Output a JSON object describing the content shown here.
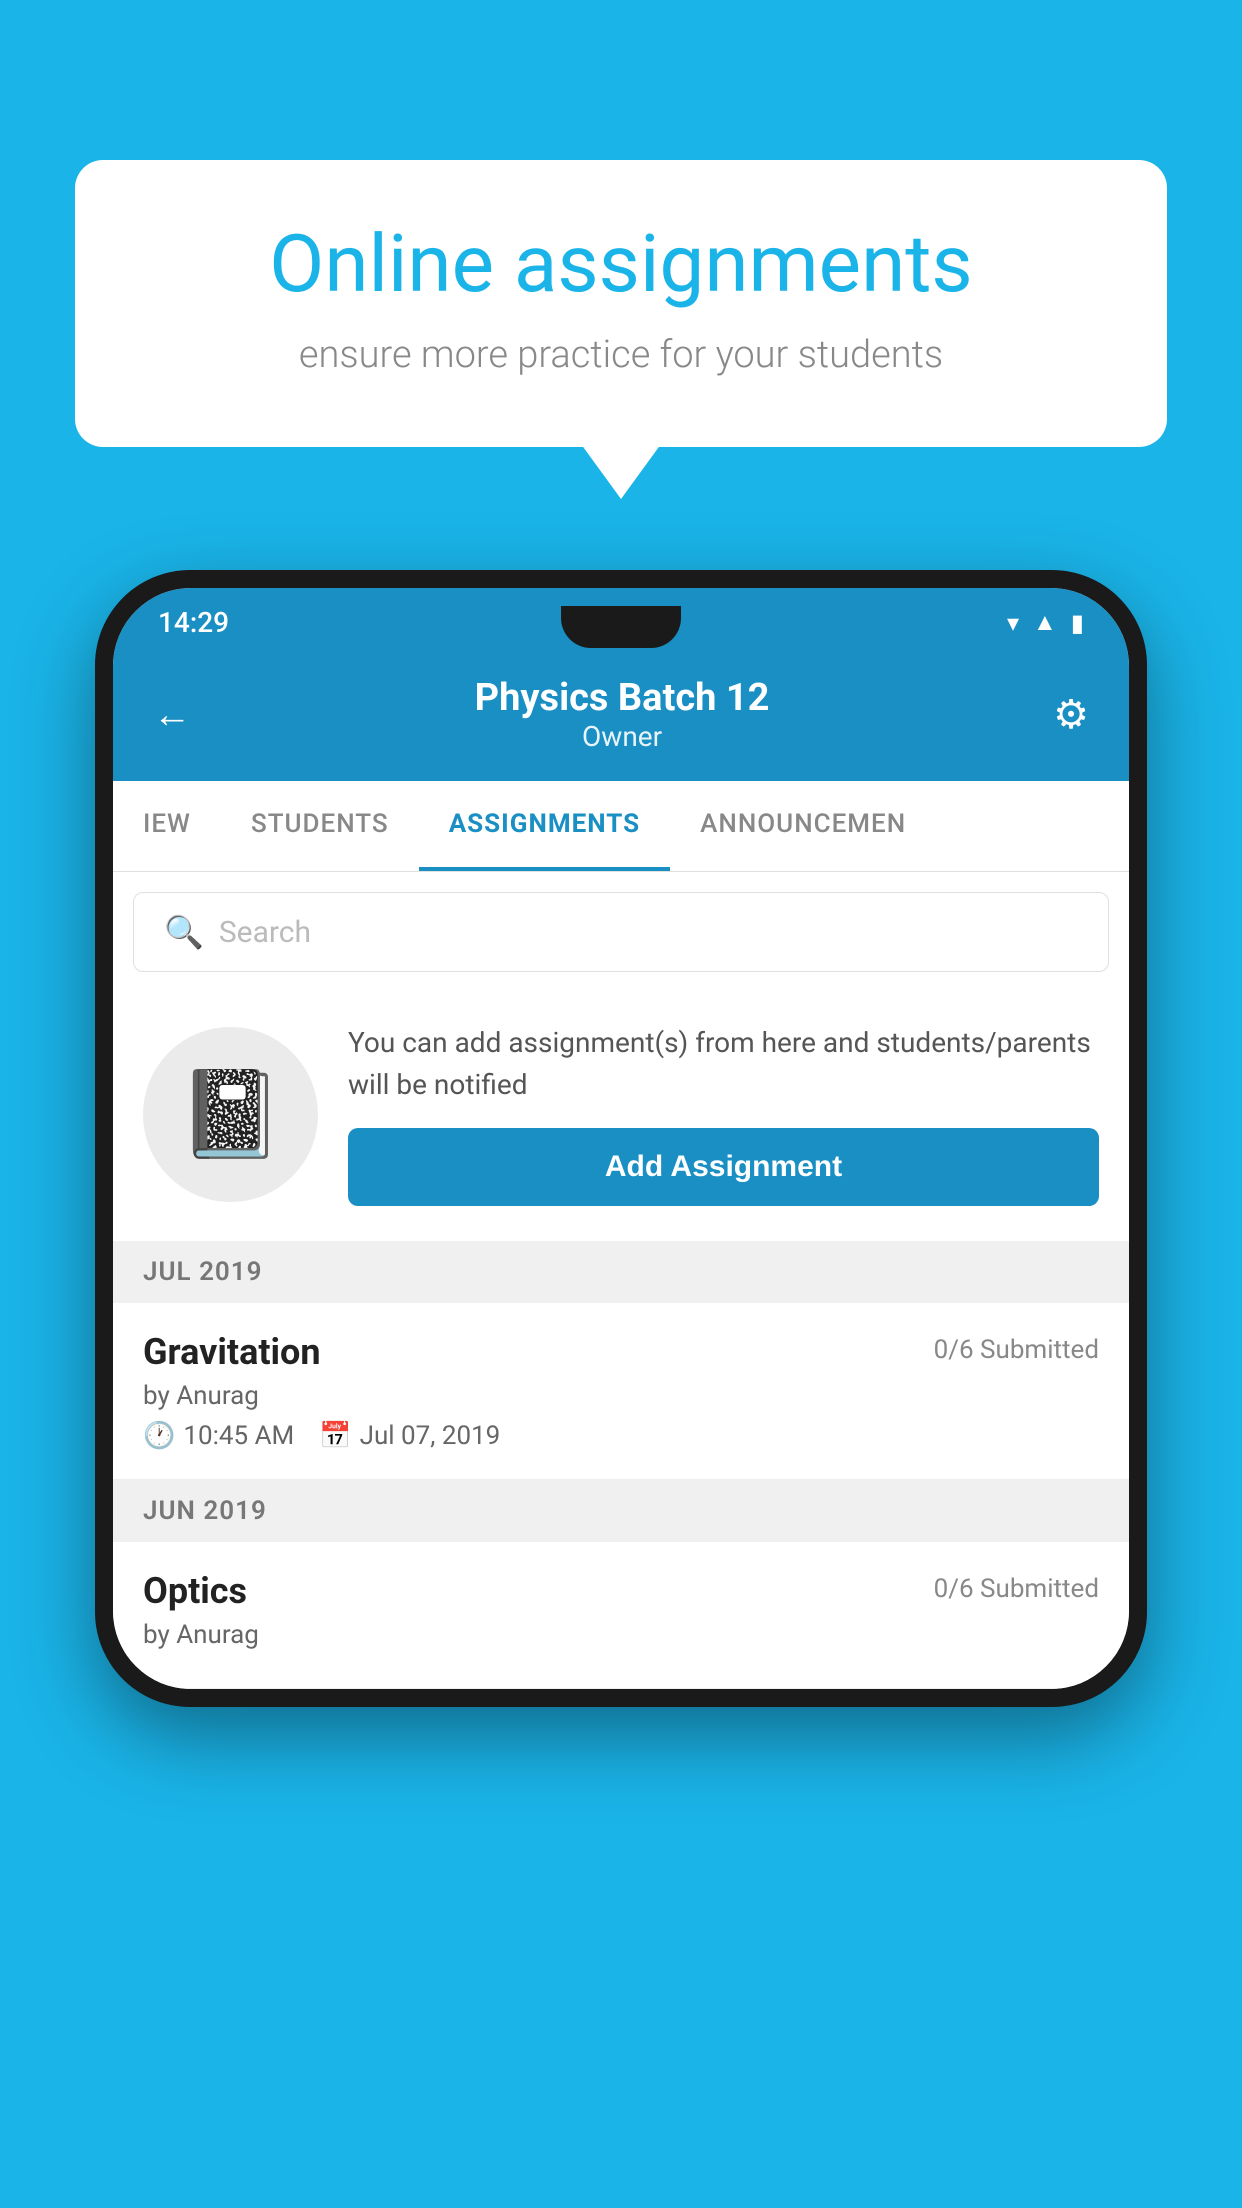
{
  "background_color": "#1ab4e8",
  "speech_bubble": {
    "title": "Online assignments",
    "subtitle": "ensure more practice for your students"
  },
  "phone": {
    "status_bar": {
      "time": "14:29",
      "icons": [
        "wifi",
        "signal",
        "battery"
      ]
    },
    "header": {
      "title": "Physics Batch 12",
      "subtitle": "Owner",
      "back_label": "←",
      "settings_label": "⚙"
    },
    "tabs": [
      {
        "label": "IEW",
        "active": false
      },
      {
        "label": "STUDENTS",
        "active": false
      },
      {
        "label": "ASSIGNMENTS",
        "active": true
      },
      {
        "label": "ANNOUNCEMENTS",
        "active": false
      }
    ],
    "search": {
      "placeholder": "Search"
    },
    "info_card": {
      "description": "You can add assignment(s) from here and students/parents will be notified",
      "button_label": "Add Assignment"
    },
    "sections": [
      {
        "month": "JUL 2019",
        "assignments": [
          {
            "name": "Gravitation",
            "submitted": "0/6 Submitted",
            "by": "by Anurag",
            "time": "10:45 AM",
            "date": "Jul 07, 2019"
          }
        ]
      },
      {
        "month": "JUN 2019",
        "assignments": [
          {
            "name": "Optics",
            "submitted": "0/6 Submitted",
            "by": "by Anurag",
            "time": "",
            "date": ""
          }
        ]
      }
    ]
  }
}
